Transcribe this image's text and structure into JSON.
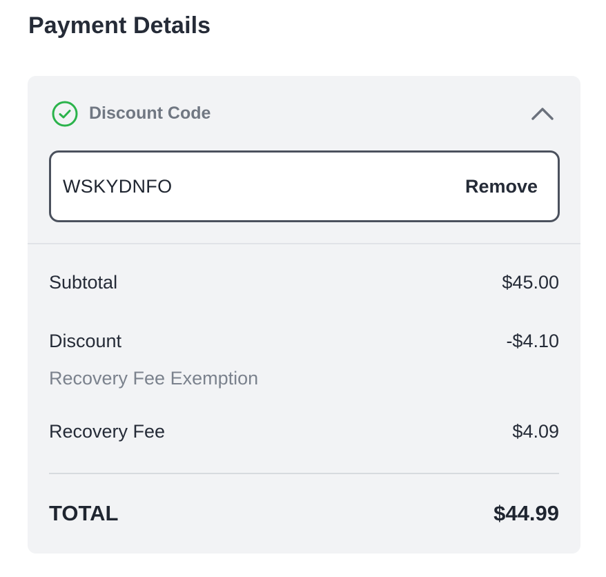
{
  "page": {
    "title": "Payment Details"
  },
  "discount": {
    "title": "Discount Code",
    "status_icon": "check-circle-icon",
    "status_color": "#2bb34b",
    "collapse_icon": "chevron-up-icon",
    "code": "WSKYDNFO",
    "remove_label": "Remove"
  },
  "summary": {
    "subtotal": {
      "label": "Subtotal",
      "value": "$45.00"
    },
    "discount": {
      "label": "Discount",
      "value": "-$4.10",
      "note": "Recovery Fee Exemption"
    },
    "recovery_fee": {
      "label": "Recovery Fee",
      "value": "$4.09"
    },
    "total": {
      "label": "TOTAL",
      "value": "$44.99"
    }
  }
}
